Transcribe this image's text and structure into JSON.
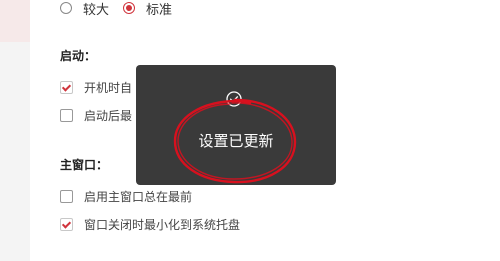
{
  "size_option": {
    "options": [
      {
        "label": "较大",
        "checked": false
      },
      {
        "label": "标准",
        "checked": true
      }
    ]
  },
  "startup": {
    "title": "启动：",
    "items": [
      {
        "label": "开机时自",
        "checked": true
      },
      {
        "label": "启动后最",
        "checked": false
      }
    ]
  },
  "main_window": {
    "title": "主窗口：",
    "items": [
      {
        "label": "启用主窗口总在最前",
        "checked": false
      },
      {
        "label": "窗口关闭时最小化到系统托盘",
        "checked": true
      }
    ]
  },
  "toast": {
    "icon": "check-circle-icon",
    "message": "设置已更新"
  },
  "colors": {
    "accent": "#d0343c",
    "toast_bg": "#3a3a3a",
    "annotation": "#d8101e"
  }
}
